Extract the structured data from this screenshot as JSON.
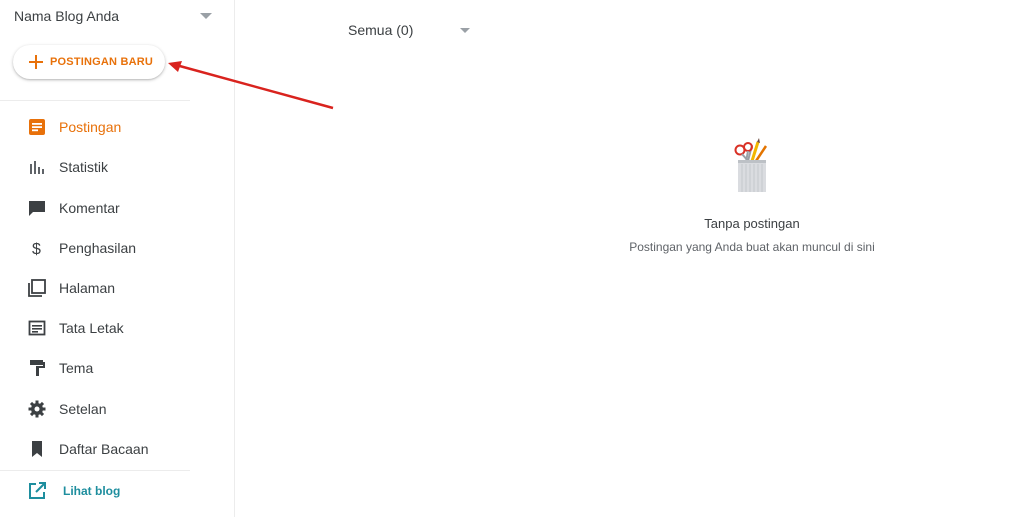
{
  "sidebar": {
    "blog_name": "Nama Blog Anda",
    "new_post_label": "POSTINGAN BARU",
    "items": [
      {
        "label": "Postingan",
        "icon": "posts-icon"
      },
      {
        "label": "Statistik",
        "icon": "stats-icon"
      },
      {
        "label": "Komentar",
        "icon": "comment-icon"
      },
      {
        "label": "Penghasilan",
        "icon": "dollar-icon"
      },
      {
        "label": "Halaman",
        "icon": "pages-icon"
      },
      {
        "label": "Tata Letak",
        "icon": "layout-icon"
      },
      {
        "label": "Tema",
        "icon": "paint-roller-icon"
      },
      {
        "label": "Setelan",
        "icon": "gear-icon"
      },
      {
        "label": "Daftar Bacaan",
        "icon": "bookmark-icon"
      }
    ],
    "view_blog_label": "Lihat blog",
    "active_color": "#e8710a"
  },
  "main": {
    "filter_label": "Semua (0)",
    "empty_title": "Tanpa postingan",
    "empty_subtitle": "Postingan yang Anda buat akan muncul di sini"
  },
  "annotation": {
    "arrow_color": "#d9231e",
    "arrow_target": "new-post-button"
  }
}
